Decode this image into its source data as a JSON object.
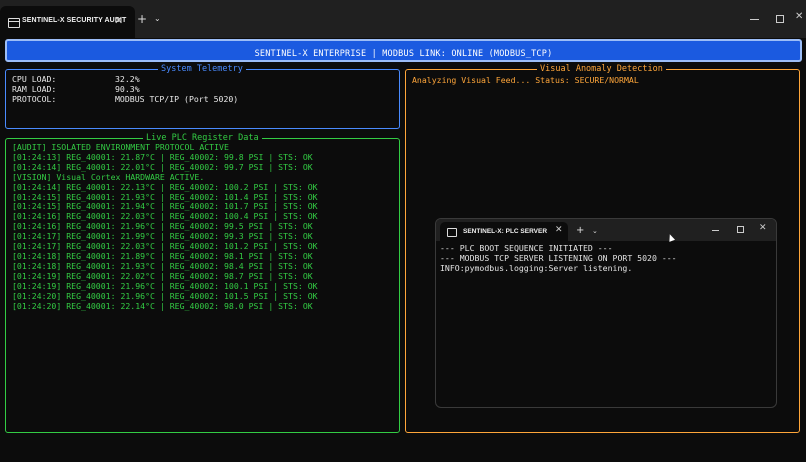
{
  "window": {
    "tab_title": "SENTINEL-X SECURITY AUDIT",
    "tab_close": "✕",
    "new_tab": "+",
    "dropdown": "⌄",
    "close": "✕"
  },
  "banner": {
    "text": "SENTINEL-X ENTERPRISE | MODBUS LINK: ONLINE (MODBUS_TCP)"
  },
  "telemetry": {
    "title": "System Telemetry",
    "rows": [
      {
        "label": "CPU LOAD:",
        "value": "32.2%"
      },
      {
        "label": "RAM LOAD:",
        "value": "90.3%"
      },
      {
        "label": "PROTOCOL:",
        "value": "MODBUS TCP/IP (Port 5020)"
      }
    ]
  },
  "vision": {
    "title": "Visual Anomaly Detection",
    "status": "Analyzing Visual Feed... Status: SECURE/NORMAL"
  },
  "plc": {
    "title": "Live PLC Register Data",
    "lines": [
      "[AUDIT] ISOLATED ENVIRONMENT PROTOCOL ACTIVE",
      "[01:24:13] REG_40001: 21.87°C | REG_40002: 99.8 PSI | STS: OK",
      "[01:24:14] REG_40001: 22.01°C | REG_40002: 99.7 PSI | STS: OK",
      "[VISION] Visual Cortex HARDWARE ACTIVE.",
      "[01:24:14] REG_40001: 22.13°C | REG_40002: 100.2 PSI | STS: OK",
      "[01:24:15] REG_40001: 21.93°C | REG_40002: 101.4 PSI | STS: OK",
      "[01:24:15] REG_40001: 21.94°C | REG_40002: 101.7 PSI | STS: OK",
      "[01:24:16] REG_40001: 22.03°C | REG_40002: 100.4 PSI | STS: OK",
      "[01:24:16] REG_40001: 21.96°C | REG_40002: 99.5 PSI | STS: OK",
      "[01:24:17] REG_40001: 21.99°C | REG_40002: 99.3 PSI | STS: OK",
      "[01:24:17] REG_40001: 22.03°C | REG_40002: 101.2 PSI | STS: OK",
      "[01:24:18] REG_40001: 21.89°C | REG_40002: 98.1 PSI | STS: OK",
      "[01:24:18] REG_40001: 21.93°C | REG_40002: 98.4 PSI | STS: OK",
      "[01:24:19] REG_40001: 22.02°C | REG_40002: 98.7 PSI | STS: OK",
      "[01:24:19] REG_40001: 21.96°C | REG_40002: 100.1 PSI | STS: OK",
      "[01:24:20] REG_40001: 21.96°C | REG_40002: 101.5 PSI | STS: OK",
      "[01:24:20] REG_40001: 22.14°C | REG_40002: 98.0 PSI | STS: OK"
    ]
  },
  "server": {
    "tab_title": "SENTINEL-X: PLC SERVER",
    "lines": [
      "--- PLC BOOT SEQUENCE INITIATED ---",
      "--- MODBUS TCP SERVER LISTENING ON PORT 5020 ---",
      "INFO:pymodbus.logging:Server listening."
    ]
  },
  "colors": {
    "banner": "#1b5ae0",
    "telemetry_border": "#4a8bff",
    "vision_border": "#ffa63a",
    "plc_text": "#33cc44",
    "background": "#0c0c0c"
  }
}
